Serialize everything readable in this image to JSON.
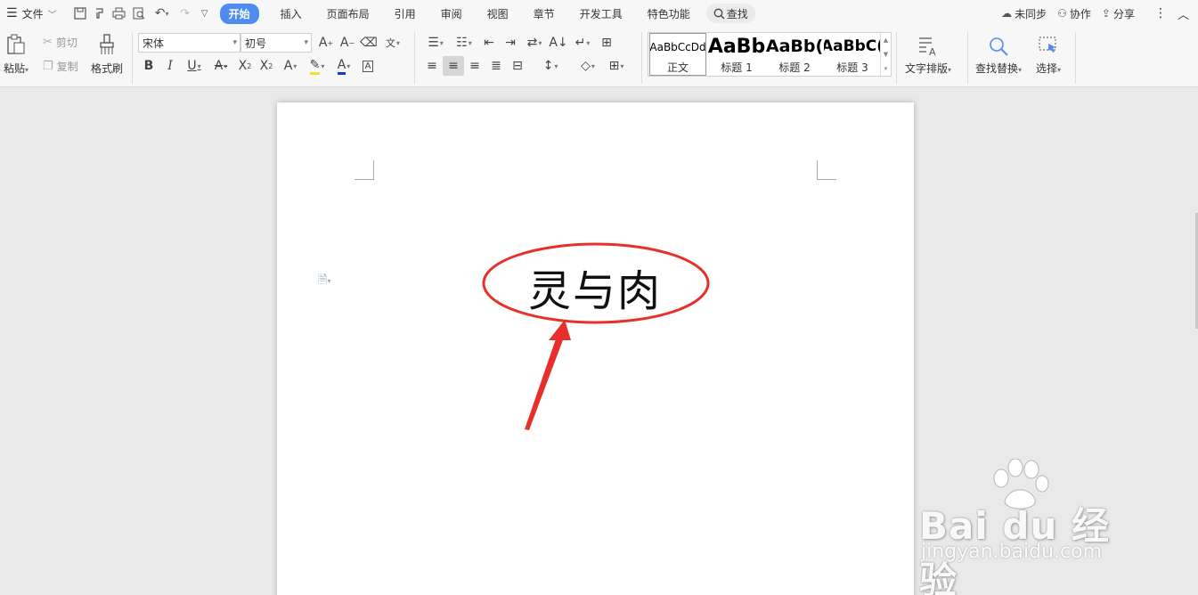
{
  "menubar": {
    "file_label": "文件",
    "tabs": [
      "开始",
      "插入",
      "页面布局",
      "引用",
      "审阅",
      "视图",
      "章节",
      "开发工具",
      "特色功能"
    ],
    "search_label": "查找",
    "sync_label": "未同步",
    "collab_label": "协作",
    "share_label": "分享"
  },
  "ribbon": {
    "paste_label": "粘贴",
    "cut_label": "剪切",
    "copy_label": "复制",
    "format_painter_label": "格式刷",
    "font_name": "宋体",
    "font_size": "初号",
    "styles": [
      {
        "preview": "AaBbCcDd",
        "name": "正文"
      },
      {
        "preview": "AaBb",
        "name": "标题 1"
      },
      {
        "preview": "AaBb(",
        "name": "标题 2"
      },
      {
        "preview": "AaBbC(",
        "name": "标题 3"
      }
    ],
    "text_layout_label": "文字排版",
    "find_replace_label": "查找替换",
    "select_label": "选择"
  },
  "document": {
    "text": "灵与肉"
  },
  "watermark": {
    "brand": "Bai du 经验",
    "url": "jingyan.baidu.com"
  },
  "colors": {
    "accent": "#4f8cf0",
    "annotation": "#e8302a",
    "highlight": "#f5e12a",
    "font_color": "#1a35d8"
  }
}
